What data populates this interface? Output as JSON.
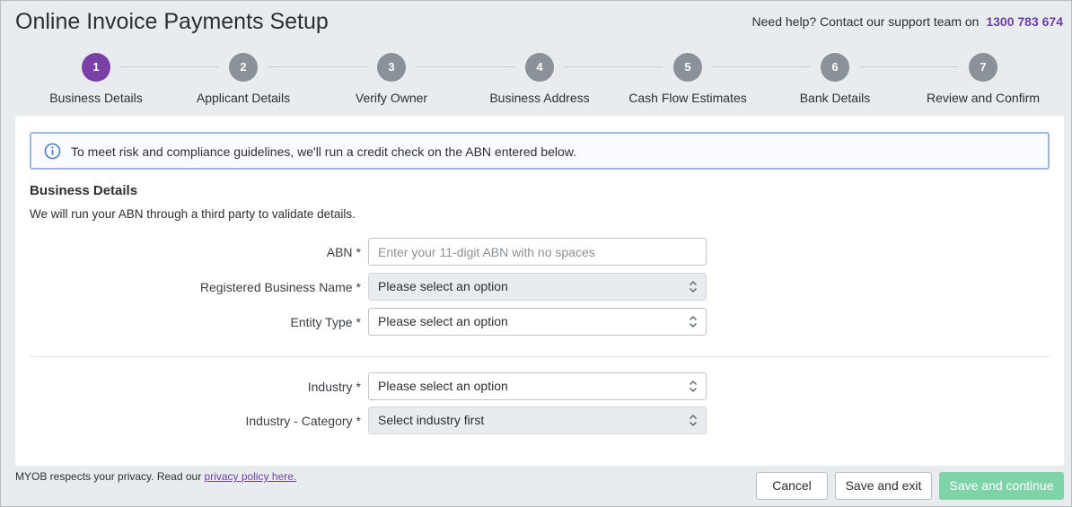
{
  "header": {
    "title": "Online Invoice Payments Setup",
    "help_text": "Need help? Contact our support team on",
    "help_phone": "1300 783 674"
  },
  "stepper": {
    "steps": [
      {
        "number": "1",
        "label": "Business Details",
        "active": true
      },
      {
        "number": "2",
        "label": "Applicant Details",
        "active": false
      },
      {
        "number": "3",
        "label": "Verify Owner",
        "active": false
      },
      {
        "number": "4",
        "label": "Business Address",
        "active": false
      },
      {
        "number": "5",
        "label": "Cash Flow Estimates",
        "active": false
      },
      {
        "number": "6",
        "label": "Bank Details",
        "active": false
      },
      {
        "number": "7",
        "label": "Review and Confirm",
        "active": false
      }
    ]
  },
  "alert": {
    "icon": "info-icon",
    "message": "To meet risk and compliance guidelines, we'll run a credit check on the ABN entered below."
  },
  "section": {
    "title": "Business Details",
    "description": "We will run your ABN through a third party to validate details."
  },
  "form": {
    "abn": {
      "label": "ABN",
      "required": "*",
      "placeholder": "Enter your 11-digit ABN with no spaces",
      "value": ""
    },
    "registered_name": {
      "label": "Registered Business Name",
      "required": "*",
      "value": "Please select an option"
    },
    "entity_type": {
      "label": "Entity Type",
      "required": "*",
      "value": "Please select an option"
    },
    "industry": {
      "label": "Industry",
      "required": "*",
      "value": "Please select an option"
    },
    "industry_category": {
      "label": "Industry - Category",
      "required": "*",
      "value": "Select industry first"
    }
  },
  "footer": {
    "privacy_text": "MYOB respects your privacy. Read our",
    "privacy_link": "privacy policy here.",
    "cancel_label": "Cancel",
    "save_exit_label": "Save and exit",
    "save_continue_label": "Save and continue"
  },
  "colors": {
    "active_step": "#7b3fa8",
    "inactive_step": "#8a9199",
    "primary_button": "#7fd3a8",
    "link": "#6b3fa0",
    "alert_border": "#9fb6df"
  }
}
